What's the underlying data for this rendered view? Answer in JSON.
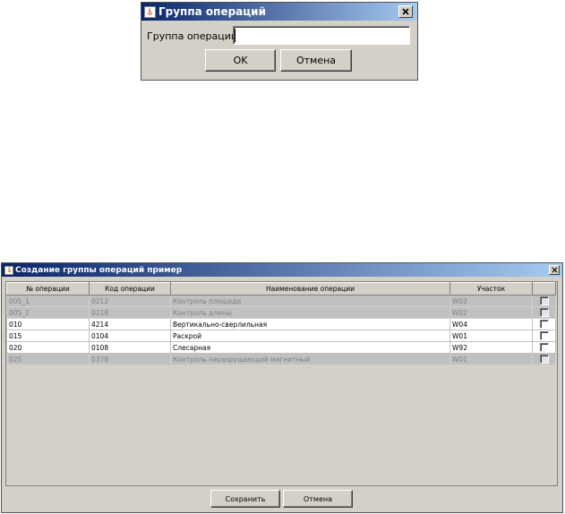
{
  "dialog1": {
    "title": "Группа операций",
    "field_label": "Группа операций:",
    "field_value": "",
    "ok_label": "OK",
    "cancel_label": "Отмена"
  },
  "dialog2": {
    "title": "Создание группы операций пример",
    "columns": [
      "№ операции",
      "Код операции",
      "Наименование операции",
      "Участок"
    ],
    "rows": [
      {
        "num": "005_1",
        "code": "0212",
        "name": "Контроль площади",
        "area": "W02",
        "enabled": false,
        "checked": false
      },
      {
        "num": "005_2",
        "code": "0218",
        "name": "Контроль длины",
        "area": "W02",
        "enabled": false,
        "checked": false
      },
      {
        "num": "010",
        "code": "4214",
        "name": "Вертикально-сверлильная",
        "area": "W04",
        "enabled": true,
        "checked": false
      },
      {
        "num": "015",
        "code": "0104",
        "name": "Раскрой",
        "area": "W01",
        "enabled": true,
        "checked": false
      },
      {
        "num": "020",
        "code": "0108",
        "name": "Слесарная",
        "area": "W92",
        "enabled": true,
        "checked": false
      },
      {
        "num": "025",
        "code": "0378",
        "name": "Контроль неразрушающий магнитный",
        "area": "W01",
        "enabled": false,
        "checked": false
      }
    ],
    "save_label": "Сохранить",
    "cancel_label": "Отмена"
  },
  "colors": {
    "title_start": "#0a246a",
    "title_end": "#a6caf0",
    "panel": "#d4d0c8",
    "disabled_row": "#c0c0c0"
  }
}
